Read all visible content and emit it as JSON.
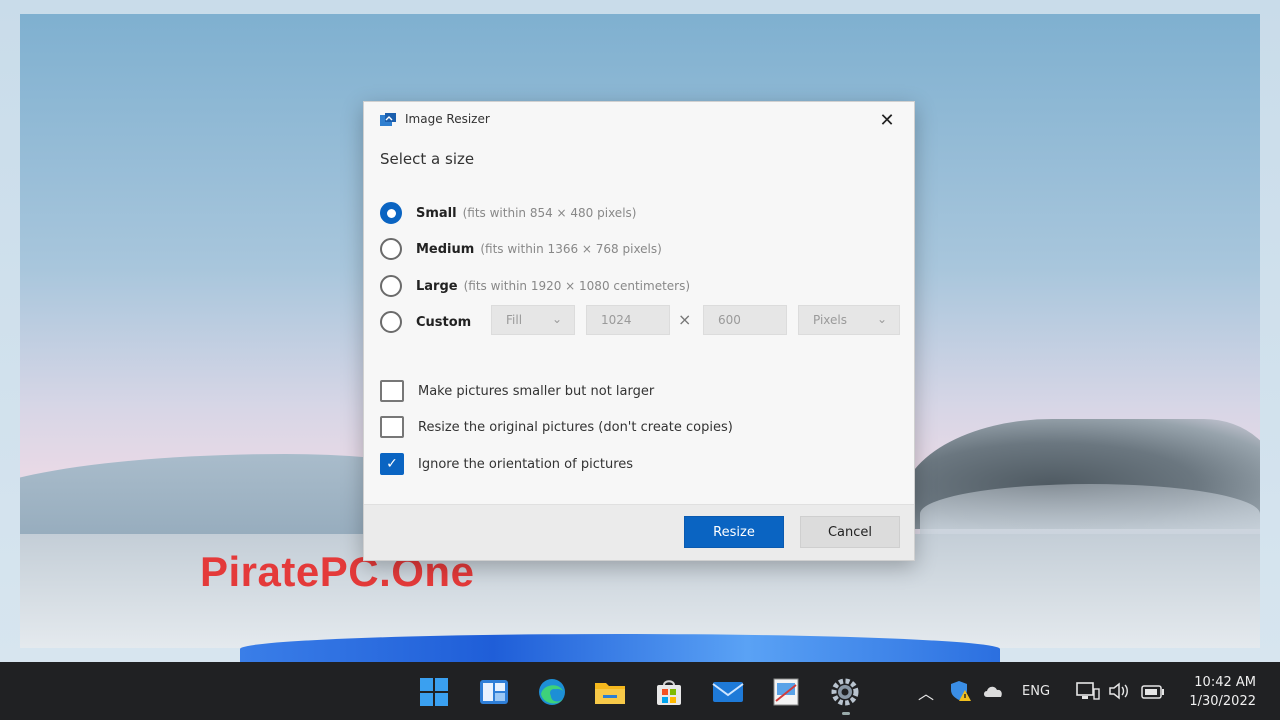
{
  "watermark": "PiratePC.One",
  "dialog": {
    "title": "Image Resizer",
    "close_glyph": "✕",
    "heading": "Select a size",
    "sizes": [
      {
        "name": "Small",
        "desc": "(fits within 854 × 480 pixels)",
        "selected": true
      },
      {
        "name": "Medium",
        "desc": "(fits within 1366 × 768 pixels)",
        "selected": false
      },
      {
        "name": "Large",
        "desc": "(fits within 1920 × 1080 centimeters)",
        "selected": false
      },
      {
        "name": "Custom",
        "desc": "",
        "selected": false
      }
    ],
    "custom": {
      "fit_mode": "Fill",
      "width": "1024",
      "times": "×",
      "height": "600",
      "unit": "Pixels"
    },
    "options": [
      {
        "label": "Make pictures smaller but not larger",
        "checked": false
      },
      {
        "label": "Resize the original pictures (don't create copies)",
        "checked": false
      },
      {
        "label": "Ignore the orientation of pictures",
        "checked": true
      }
    ],
    "resize_label": "Resize",
    "cancel_label": "Cancel"
  },
  "taskbar": {
    "icons": [
      "windows-start-icon",
      "widgets-icon",
      "edge-browser-icon",
      "file-explorer-icon",
      "microsoft-store-icon",
      "mail-icon",
      "image-editor-icon",
      "settings-gear-icon"
    ],
    "language": "ENG",
    "time": "10:42 AM",
    "date": "1/30/2022"
  },
  "colors": {
    "accent": "#0a64c2",
    "watermark": "#e43a3a",
    "taskbar": "#202123"
  }
}
